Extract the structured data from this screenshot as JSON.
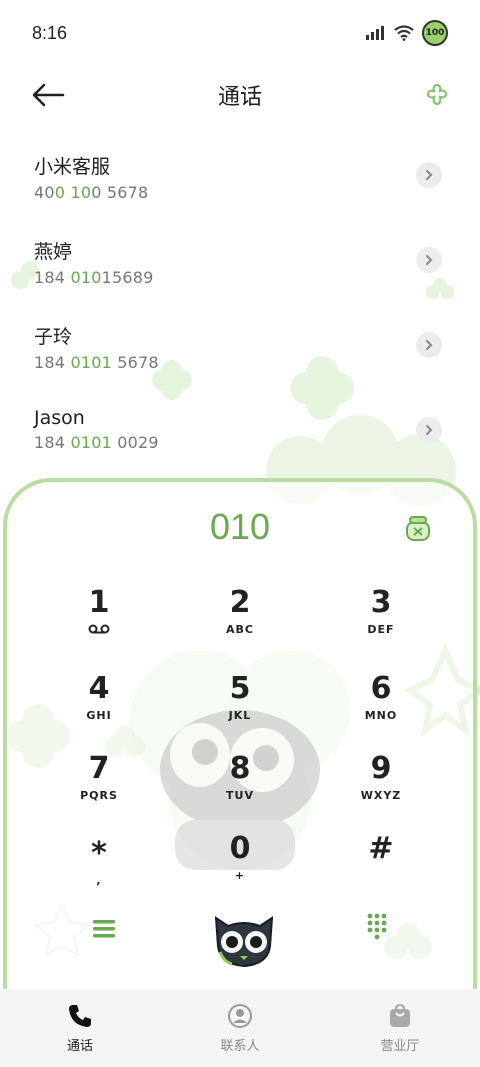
{
  "status_bar": {
    "time": "8:16",
    "battery": "100",
    "signal_icon": "signal-icon",
    "wifi_icon": "wifi-icon"
  },
  "header": {
    "title": "通话"
  },
  "contacts": [
    {
      "name": "小米客服",
      "number_parts": [
        "40",
        "0",
        " ",
        "10",
        "0 5678"
      ],
      "highlight": [
        false,
        true,
        false,
        true,
        false
      ]
    },
    {
      "name": "燕婷",
      "number_parts": [
        "184 ",
        "010",
        "15689"
      ],
      "highlight": [
        false,
        true,
        false
      ]
    },
    {
      "name": "子玲",
      "number_parts": [
        "184 ",
        "0101",
        " 5678"
      ],
      "highlight": [
        false,
        true,
        false
      ]
    },
    {
      "name": "Jason",
      "number_parts": [
        "184 ",
        "0101",
        " 0029"
      ],
      "highlight": [
        false,
        true,
        false
      ]
    }
  ],
  "dialpad": {
    "input": "010",
    "keys": [
      {
        "digit": "1",
        "letters": ""
      },
      {
        "digit": "2",
        "letters": "ABC"
      },
      {
        "digit": "3",
        "letters": "DEF"
      },
      {
        "digit": "4",
        "letters": "GHI"
      },
      {
        "digit": "5",
        "letters": "JKL"
      },
      {
        "digit": "6",
        "letters": "MNO"
      },
      {
        "digit": "7",
        "letters": "PQRS"
      },
      {
        "digit": "8",
        "letters": "TUV"
      },
      {
        "digit": "9",
        "letters": "WXYZ"
      },
      {
        "digit": "*",
        "letters": ","
      },
      {
        "digit": "0",
        "letters": "+"
      },
      {
        "digit": "#",
        "letters": ""
      }
    ]
  },
  "tabs": [
    {
      "label": "通话",
      "icon": "phone-icon",
      "active": true
    },
    {
      "label": "联系人",
      "icon": "person-icon",
      "active": false
    },
    {
      "label": "营业厅",
      "icon": "bag-icon",
      "active": false
    }
  ],
  "colors": {
    "accent": "#6aa84f",
    "border": "#b9dca0"
  }
}
